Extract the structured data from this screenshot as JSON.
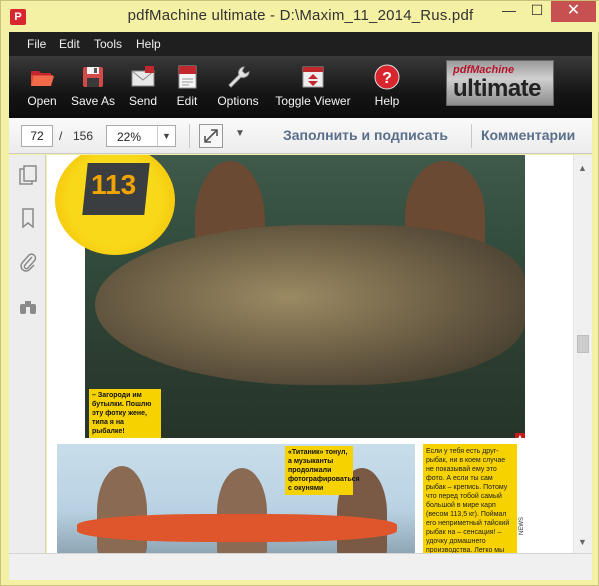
{
  "window": {
    "title": "pdfMachine ultimate - D:\\Maxim_11_2014_Rus.pdf",
    "app_icon": "P",
    "minimize": "—",
    "maximize": "☐",
    "close": "✕"
  },
  "menu": {
    "items": [
      "File",
      "Edit",
      "Tools",
      "Help"
    ]
  },
  "toolbar": {
    "buttons": [
      {
        "label": "Open",
        "icon": "folder-open-icon"
      },
      {
        "label": "Save As",
        "icon": "floppy-disk-icon"
      },
      {
        "label": "Send",
        "icon": "envelope-icon"
      },
      {
        "label": "Edit",
        "icon": "pdf-edit-icon"
      },
      {
        "label": "Options",
        "icon": "wrench-icon"
      },
      {
        "label": "Toggle Viewer",
        "icon": "toggle-viewer-icon"
      },
      {
        "label": "Help",
        "icon": "help-icon"
      }
    ],
    "brand_top": "pdfMachine",
    "brand_main": "ultimate"
  },
  "navbar": {
    "page_current": "72",
    "page_sep": "/",
    "page_total": "156",
    "zoom": "22%",
    "fill_sign": "Заполнить и подписать",
    "comments": "Комментарии"
  },
  "left_panel": {
    "icons": [
      "pages-icon",
      "bookmark-icon",
      "attachment-icon",
      "binoculars-icon"
    ]
  },
  "document": {
    "badge_number": "113",
    "caption_top": "– Загороди им бутылки. Пошлю эту фотку жене, типа я на рыбалке!",
    "caption_bottom": "«Титаник» тонул, а музыканты продолжали фотографироваться с окунями",
    "sidebar_text": "Если у тебя есть друг-рыбак, ни в коем случае не показывай ему это фото. А если ты сам рыбак – крепись. Потому что перед тобой самый большой в мире карп (весом 113,5 кг). Поймал его неприметный тайский рыбак на – сенсация! – удочку домашнего производства. Легко мы теперь не можем смотреть на свой электрический",
    "news_tag": "NEWS"
  },
  "colors": {
    "title_bg": "#f4f0a4",
    "toolbar_bg": "#151515",
    "accent_blue": "#5a6f8a",
    "caption_yellow": "#f6d200"
  }
}
